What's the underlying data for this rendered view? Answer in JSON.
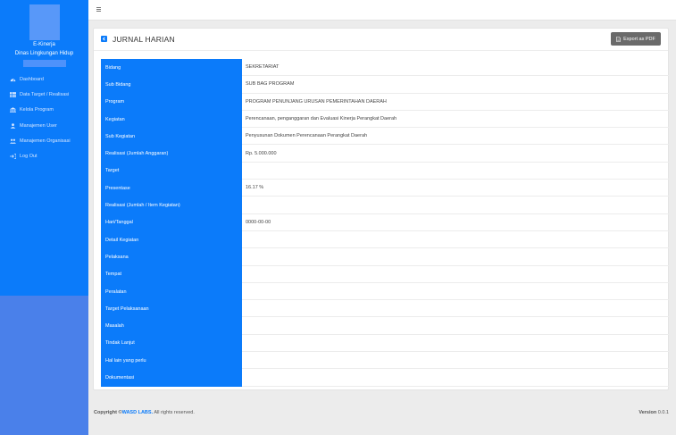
{
  "sidebar": {
    "app_name": "E-Kinerja",
    "org_name": "Dinas Lingkungan Hidup",
    "items": [
      {
        "label": "Dashboard",
        "icon": "dashboard-icon"
      },
      {
        "label": "Data Target / Realisasi",
        "icon": "table-icon"
      },
      {
        "label": "Kelola Program",
        "icon": "building-icon"
      },
      {
        "label": "Manajemen User",
        "icon": "user-icon"
      },
      {
        "label": "Manajemen Organisasi",
        "icon": "users-icon"
      },
      {
        "label": "Log Out",
        "icon": "logout-icon"
      }
    ]
  },
  "topbar": {
    "menu_icon": "hamburger-icon"
  },
  "card": {
    "title": "JURNAL HARIAN",
    "export_label": "Export as PDF"
  },
  "table": {
    "rows": [
      {
        "label": "Bidang",
        "value": "SEKRETARIAT"
      },
      {
        "label": "Sub Bidang",
        "value": "SUB BAG PROGRAM"
      },
      {
        "label": "Program",
        "value": "PROGRAM PENUNJANG URUSAN PEMERINTAHAN DAERAH"
      },
      {
        "label": "Kegiatan",
        "value": "Perencanaan, penganggaran dan Evaluasi Kinerja Perangkat Daerah"
      },
      {
        "label": "Sub Kegiatan",
        "value": "Penyusunan Dokumen Perencanaan Perangkat Daerah"
      },
      {
        "label": "Realisasi (Jumlah Anggaran)",
        "value": "Rp. 5.000.000"
      },
      {
        "label": "Target",
        "value": ""
      },
      {
        "label": "Presentase",
        "value": "16.17 %"
      },
      {
        "label": "Realisasi (Jumlah / Item Kegiatan)",
        "value": ""
      },
      {
        "label": "Hari/Tanggal",
        "value": "0000-00-00"
      },
      {
        "label": "Detail Kegiatan",
        "value": ""
      },
      {
        "label": "Pelaksana",
        "value": ""
      },
      {
        "label": "Tempat",
        "value": ""
      },
      {
        "label": "Peralatan",
        "value": ""
      },
      {
        "label": "Target Pelaksanaan",
        "value": ""
      },
      {
        "label": "Masalah",
        "value": ""
      },
      {
        "label": "Tindak Lanjut",
        "value": ""
      },
      {
        "label": "Hal lain yang perlu",
        "value": ""
      },
      {
        "label": "Dokumentasi",
        "value": ""
      }
    ]
  },
  "footer": {
    "copyright_prefix": "Copyright ©",
    "company": "WASD LABS.",
    "rights": " All rights reserved.",
    "version_label": "Version",
    "version_number": " 0.0.1"
  },
  "colors": {
    "primary": "#0b7bfa",
    "sidebar_bottom": "#4a80ea",
    "export_button": "#6a6a6a"
  }
}
